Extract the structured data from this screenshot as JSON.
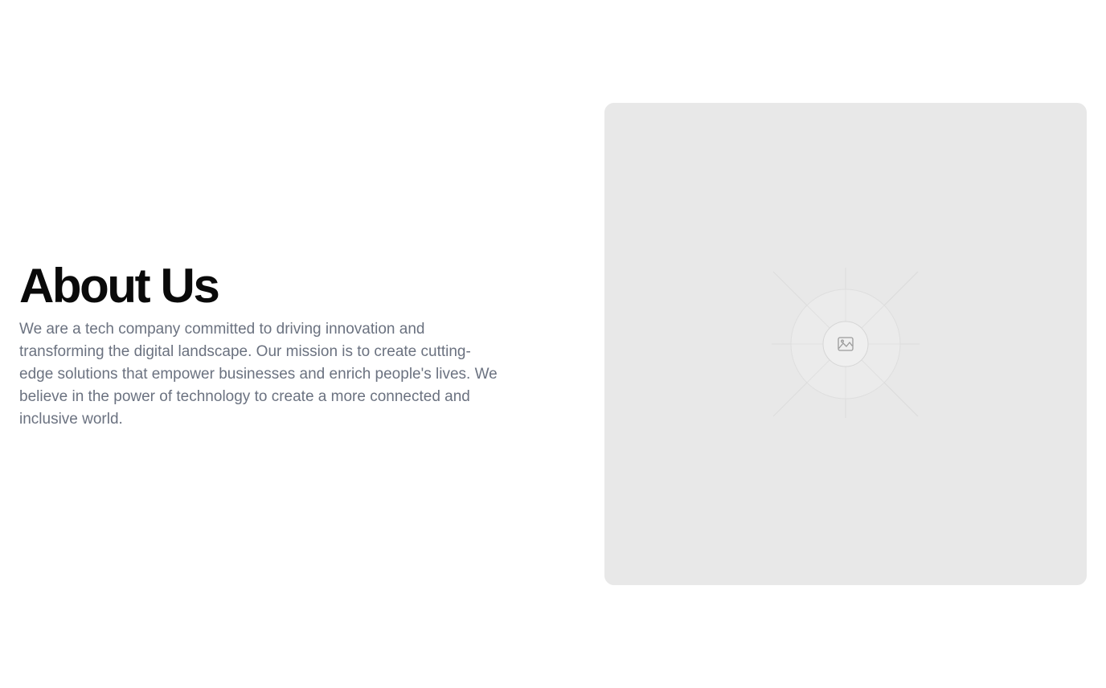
{
  "about": {
    "title": "About Us",
    "description": "We are a tech company committed to driving innovation and transforming the digital landscape. Our mission is to create cutting-edge solutions that empower businesses and enrich people's lives. We believe in the power of technology to create a more connected and inclusive world."
  },
  "image_placeholder": {
    "icon": "image-icon",
    "background_color": "#e8e8e8"
  },
  "colors": {
    "title": "#0a0a0a",
    "body_text": "#6b7280",
    "page_background": "#ffffff"
  }
}
